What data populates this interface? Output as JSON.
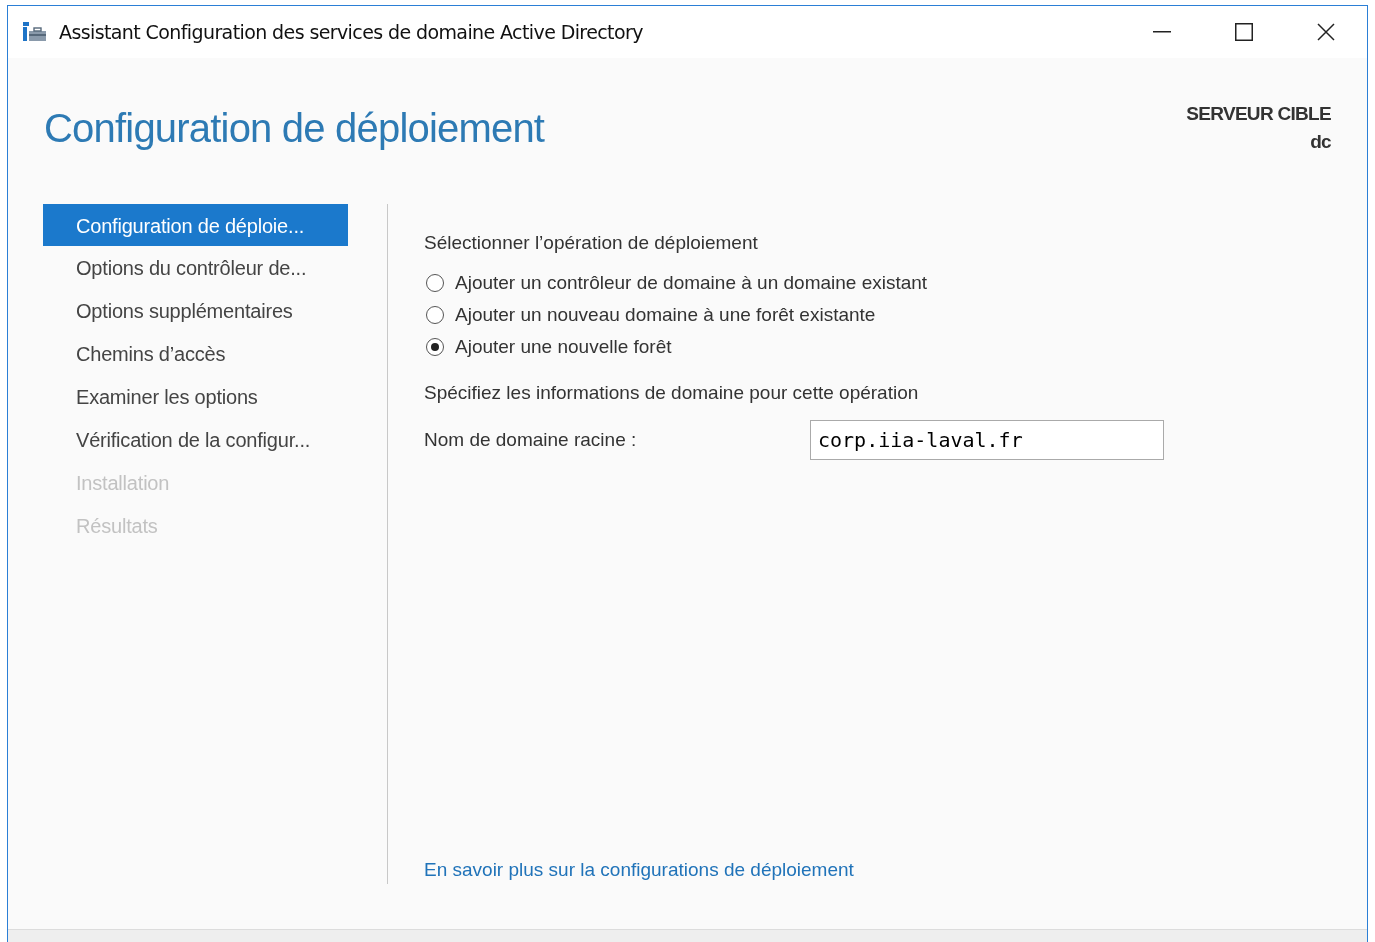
{
  "window": {
    "title": "Assistant Configuration des services de domaine Active Directory"
  },
  "header": {
    "title": "Configuration de déploiement",
    "target_label": "SERVEUR CIBLE",
    "target_value": "dc"
  },
  "sidebar": {
    "items": [
      {
        "label": "Configuration de déploie...",
        "selected": true,
        "disabled": false
      },
      {
        "label": "Options du contrôleur de...",
        "selected": false,
        "disabled": false
      },
      {
        "label": "Options supplémentaires",
        "selected": false,
        "disabled": false
      },
      {
        "label": "Chemins d’accès",
        "selected": false,
        "disabled": false
      },
      {
        "label": "Examiner les options",
        "selected": false,
        "disabled": false
      },
      {
        "label": "Vérification de la configur...",
        "selected": false,
        "disabled": false
      },
      {
        "label": "Installation",
        "selected": false,
        "disabled": true
      },
      {
        "label": "Résultats",
        "selected": false,
        "disabled": true
      }
    ]
  },
  "operation": {
    "heading": "Sélectionner l’opération de déploiement",
    "options": [
      {
        "label": "Ajouter un contrôleur de domaine à un domaine existant",
        "selected": false
      },
      {
        "label": "Ajouter un nouveau domaine à une forêt existante",
        "selected": false
      },
      {
        "label": "Ajouter une nouvelle forêt",
        "selected": true
      }
    ]
  },
  "domain": {
    "heading": "Spécifiez les informations de domaine pour cette opération",
    "field_label": "Nom de domaine racine :",
    "value": "corp.iia-laval.fr"
  },
  "link": "En savoir plus sur la configurations de déploiement"
}
